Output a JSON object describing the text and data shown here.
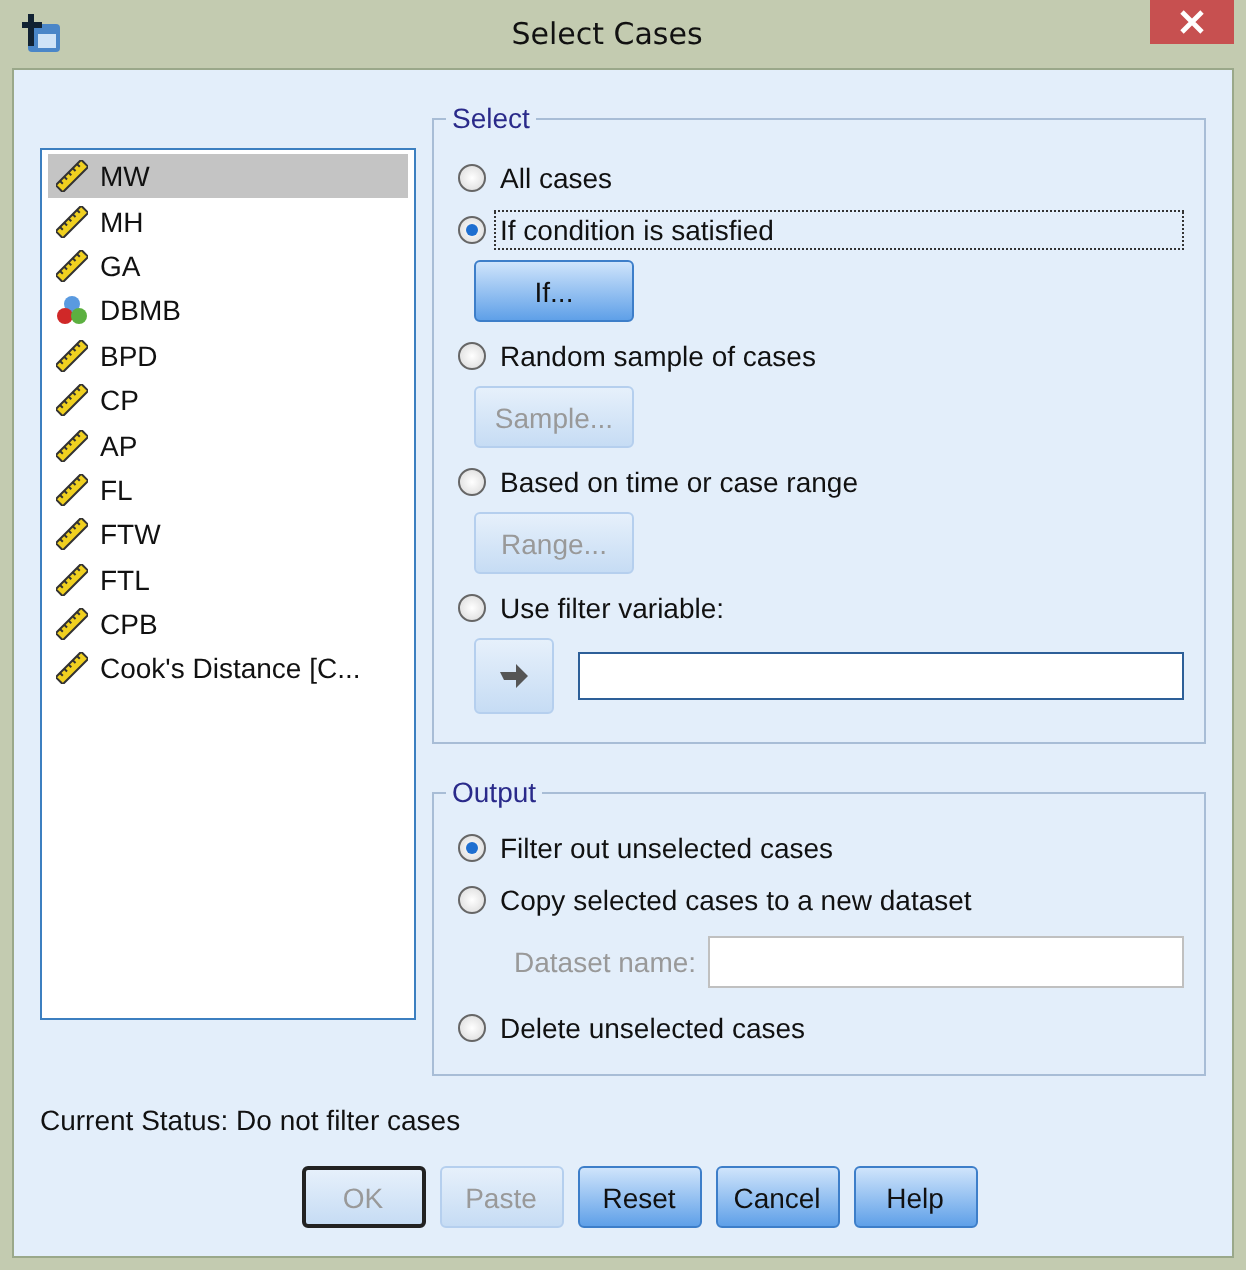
{
  "window": {
    "title": "Select Cases"
  },
  "variables": [
    {
      "name": "MW",
      "kind": "scale",
      "selected": true
    },
    {
      "name": "MH",
      "kind": "scale",
      "selected": false
    },
    {
      "name": "GA",
      "kind": "scale",
      "selected": false
    },
    {
      "name": "DBMB",
      "kind": "nominal",
      "selected": false
    },
    {
      "name": "BPD",
      "kind": "scale",
      "selected": false
    },
    {
      "name": "CP",
      "kind": "scale",
      "selected": false
    },
    {
      "name": "AP",
      "kind": "scale",
      "selected": false
    },
    {
      "name": "FL",
      "kind": "scale",
      "selected": false
    },
    {
      "name": "FTW",
      "kind": "scale",
      "selected": false
    },
    {
      "name": "FTL",
      "kind": "scale",
      "selected": false
    },
    {
      "name": "CPB",
      "kind": "scale",
      "selected": false
    },
    {
      "name": "Cook's Distance [C...",
      "kind": "scale",
      "selected": false
    }
  ],
  "select": {
    "title": "Select",
    "options": [
      {
        "label": "All cases",
        "selected": false,
        "focused": false
      },
      {
        "label": "If condition is satisfied",
        "selected": true,
        "focused": true,
        "button": {
          "label": "If...",
          "disabled": false
        }
      },
      {
        "label": "Random sample of cases",
        "selected": false,
        "focused": false,
        "button": {
          "label": "Sample...",
          "disabled": true
        }
      },
      {
        "label": "Based on time or case range",
        "selected": false,
        "focused": false,
        "button": {
          "label": "Range...",
          "disabled": true
        }
      },
      {
        "label": "Use filter variable:",
        "selected": false,
        "focused": false,
        "move_button": {
          "disabled": true
        }
      }
    ]
  },
  "output": {
    "title": "Output",
    "options": [
      {
        "label": "Filter out unselected cases",
        "selected": true
      },
      {
        "label": "Copy selected cases to a new dataset",
        "selected": false,
        "dataset_name": {
          "label": "Dataset name:",
          "disabled": true
        }
      },
      {
        "label": "Delete unselected cases",
        "selected": false
      }
    ]
  },
  "status": "Current Status: Do not filter cases",
  "buttons": [
    {
      "label": "OK",
      "disabled": true,
      "default": true
    },
    {
      "label": "Paste",
      "disabled": true,
      "default": false
    },
    {
      "label": "Reset",
      "disabled": false,
      "default": false
    },
    {
      "label": "Cancel",
      "disabled": false,
      "default": false
    },
    {
      "label": "Help",
      "disabled": false,
      "default": false
    }
  ]
}
